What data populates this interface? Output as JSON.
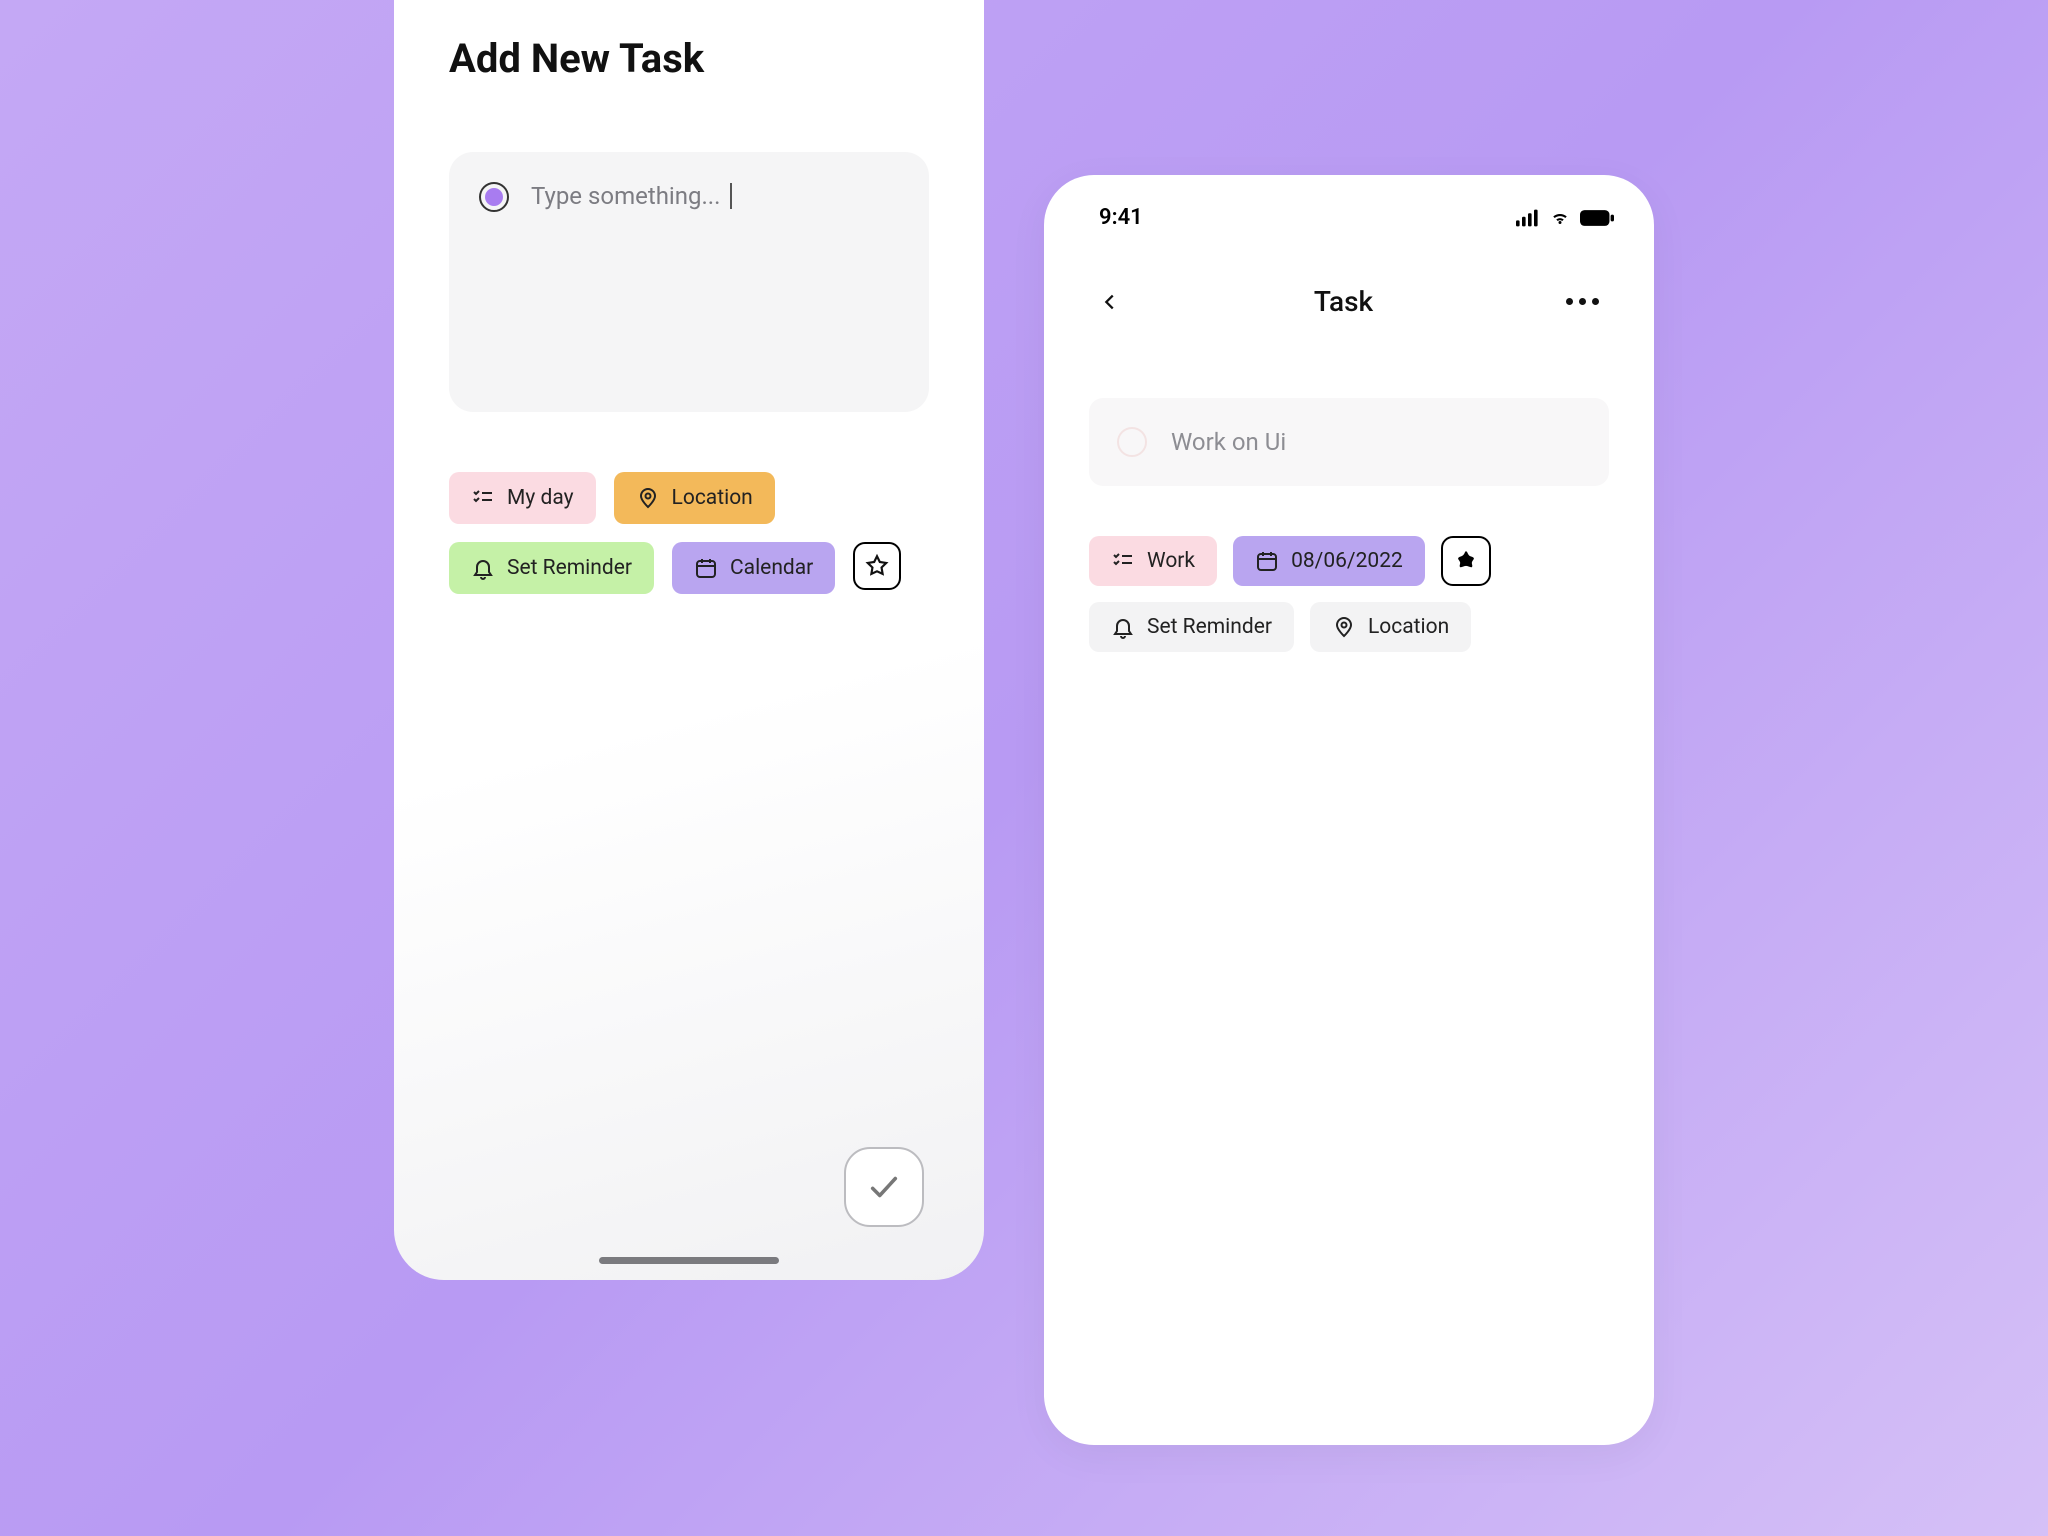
{
  "left": {
    "title": "Add New Task",
    "placeholder": "Type something...",
    "chips": {
      "myday": "My day",
      "location": "Location",
      "reminder": "Set Reminder",
      "calendar": "Calendar"
    }
  },
  "right": {
    "status_time": "9:41",
    "nav_title": "Task",
    "task_text": "Work on Ui",
    "chips": {
      "work": "Work",
      "date": "08/06/2022",
      "reminder": "Set Reminder",
      "location": "Location"
    }
  },
  "colors": {
    "pink": "#fbdbe2",
    "orange": "#f3b95a",
    "green": "#c5f1a7",
    "purple": "#b9a5f0",
    "gray": "#f3f3f4"
  }
}
